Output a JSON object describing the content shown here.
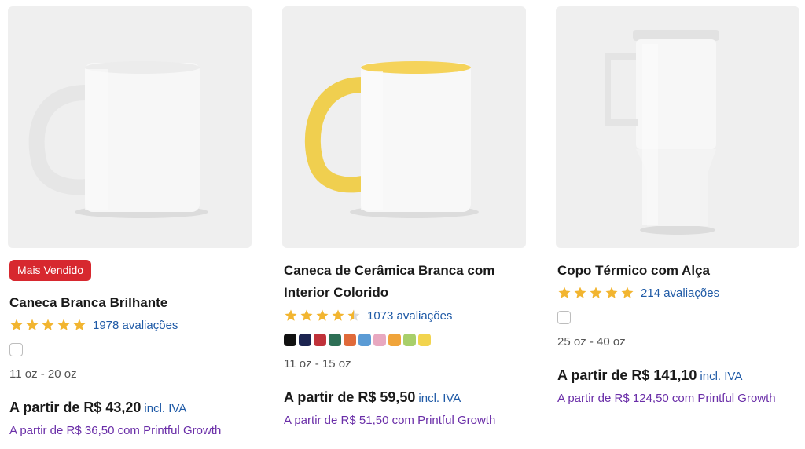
{
  "products": [
    {
      "badge": "Mais Vendido",
      "title_lines": [
        "Caneca Branca Brilhante"
      ],
      "rating": 5,
      "reviews": "1978 avaliações",
      "sizes": "11 oz - 20 oz",
      "price": "A partir de R$ 43,20",
      "vat": "incl. IVA",
      "growth_price": "A partir de R$ 36,50 com Printful Growth",
      "swatch_colors": [
        "#ffffff"
      ]
    },
    {
      "title_lines": [
        "Caneca de Cerâmica Branca com",
        "Interior Colorido"
      ],
      "rating": 4.5,
      "reviews": "1073 avaliações",
      "sizes": "11 oz - 15 oz",
      "price": "A partir de R$ 59,50",
      "vat": "incl. IVA",
      "growth_price": "A partir de R$ 51,50 com Printful Growth",
      "swatch_colors": [
        "#111111",
        "#1c2450",
        "#c0323a",
        "#2d6f55",
        "#e06a3a",
        "#5b9bd5",
        "#e8a8c0",
        "#f0a43a",
        "#a8cf6a",
        "#f2d44e"
      ]
    },
    {
      "title_lines": [
        "Copo Térmico com Alça"
      ],
      "rating": 5,
      "reviews": "214 avaliações",
      "sizes": "25 oz - 40 oz",
      "price": "A partir de R$ 141,10",
      "vat": "incl. IVA",
      "growth_price": "A partir de R$ 124,50 com Printful Growth",
      "swatch_colors": [
        "#ffffff"
      ]
    }
  ],
  "colors": {
    "badge": "#d7282f",
    "star": "#f2b530",
    "link": "#1f5aa6",
    "growth": "#6a2ea8"
  },
  "icons": {
    "star": "star-icon",
    "checkbox": "color-swatch-white"
  }
}
